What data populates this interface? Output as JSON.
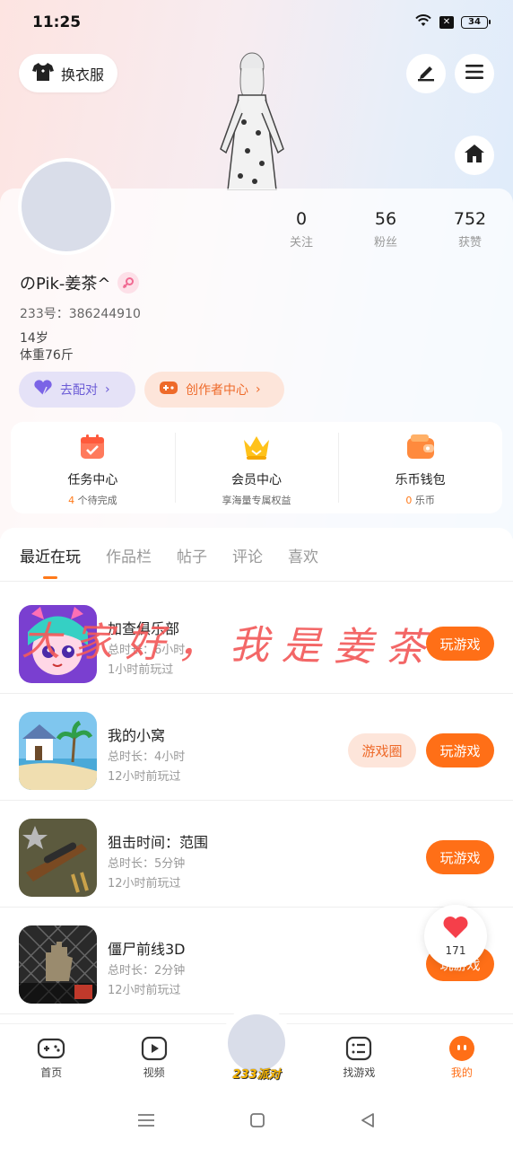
{
  "status_bar": {
    "time": "11:25",
    "battery": "34"
  },
  "header": {
    "outfit_label": "换衣服"
  },
  "profile": {
    "stats": [
      {
        "num": "0",
        "label": "关注"
      },
      {
        "num": "56",
        "label": "粉丝"
      },
      {
        "num": "752",
        "label": "获赞"
      }
    ],
    "nickname": "のPik-姜茶^",
    "uid": "233号：386244910",
    "age": "14岁",
    "weight": "体重76斤",
    "match_label": "去配对",
    "creator_label": "创作者中心"
  },
  "quick": [
    {
      "title": "任务中心",
      "sub_hl": "4",
      "sub": " 个待完成"
    },
    {
      "title": "会员中心",
      "sub_hl": "",
      "sub": "享海量专属权益"
    },
    {
      "title": "乐币钱包",
      "sub_hl": "0",
      "sub": " 乐币"
    }
  ],
  "tabs": [
    "最近在玩",
    "作品栏",
    "帖子",
    "评论",
    "喜欢"
  ],
  "games": [
    {
      "name": "加查俱乐部",
      "duration": "总时长：6小时",
      "last": "1小时前玩过",
      "play": "玩游戏"
    },
    {
      "name": "我的小窝",
      "duration": "总时长：4小时",
      "last": "12小时前玩过",
      "play": "玩游戏",
      "circle": "游戏圈"
    },
    {
      "name": "狙击时间：范围",
      "duration": "总时长：5分钟",
      "last": "12小时前玩过",
      "play": "玩游戏"
    },
    {
      "name": "僵尸前线3D",
      "duration": "总时长：2分钟",
      "last": "12小时前玩过",
      "play": "玩游戏"
    }
  ],
  "overlay": "大家好，我是姜茶",
  "like": {
    "count": "171"
  },
  "bottom_nav": [
    {
      "label": "首页"
    },
    {
      "label": "视频"
    },
    {
      "label": "找游戏"
    },
    {
      "label": "我的"
    }
  ],
  "center_label": "233派对",
  "colors": {
    "accent": "#ff6f17",
    "purple": "#6b5bd6"
  }
}
